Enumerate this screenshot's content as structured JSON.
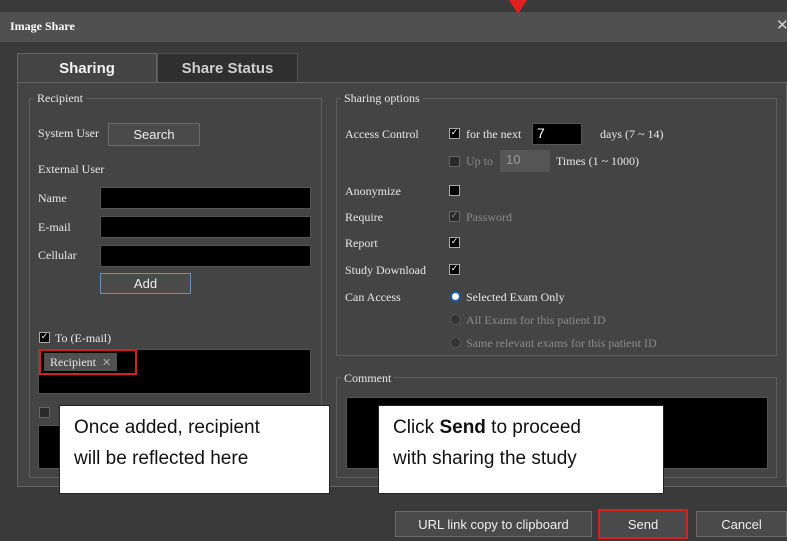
{
  "dialog": {
    "title": "Image Share",
    "close_glyph": "✕"
  },
  "tabs": [
    {
      "label": "Sharing",
      "active": true
    },
    {
      "label": "Share Status",
      "active": false
    }
  ],
  "recipient": {
    "group_label": "Recipient",
    "system_user_label": "System User",
    "search_button": "Search",
    "external_user_label": "External User",
    "name_label": "Name",
    "email_label": "E-mail",
    "cellular_label": "Cellular",
    "add_button": "Add",
    "to_email_label": "To (E-mail)",
    "to_email_checked": true,
    "recipient_chip": "Recipient",
    "chip_remove_glyph": "✕"
  },
  "sharing_options": {
    "group_label": "Sharing options",
    "access_control_label": "Access Control",
    "for_next_label": "for the next",
    "days_value": "7",
    "days_range": "days (7 ~ 14)",
    "up_to_label": "Up to",
    "times_value": "10",
    "times_range": "Times (1 ~ 1000)",
    "anonymize_label": "Anonymize",
    "require_label": "Require",
    "password_label": "Password",
    "report_label": "Report",
    "study_download_label": "Study Download",
    "can_access_label": "Can Access",
    "access_options": [
      "Selected Exam Only",
      "All Exams for this patient ID",
      "Same relevant exams for this patient ID"
    ],
    "selected_access_option": 0
  },
  "comment": {
    "group_label": "Comment"
  },
  "footer": {
    "url_copy_button": "URL link copy to clipboard",
    "send_button": "Send",
    "cancel_button": "Cancel"
  },
  "callouts": {
    "recipient_note_line1": "Once added, recipient",
    "recipient_note_line2": "will be reflected here",
    "send_note_pre": "Click ",
    "send_note_bold": "Send",
    "send_note_post": " to proceed",
    "send_note_line2": "with sharing the study"
  },
  "colors": {
    "highlight": "#d62020",
    "dialog_bg": "#3a3a3a",
    "radio_accent": "#1b5a9c"
  }
}
